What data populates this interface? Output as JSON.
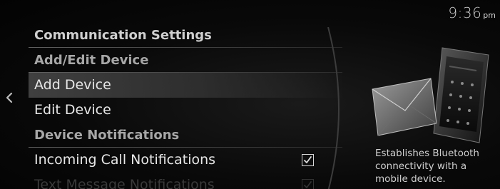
{
  "status": {
    "time": "9:36",
    "ampm": "pm"
  },
  "navigation": {
    "back_icon": "chevron-left-icon"
  },
  "menu": {
    "title": "Communication Settings",
    "section_add_edit": "Add/Edit Device",
    "items": [
      {
        "label": "Add Device",
        "selected": true
      },
      {
        "label": "Edit Device",
        "selected": false
      }
    ],
    "section_notifications": "Device Notifications",
    "notification_items": [
      {
        "label": "Incoming Call Notifications",
        "checked": true
      },
      {
        "label": "Text Message Notifications",
        "checked": true
      }
    ]
  },
  "info_panel": {
    "illustration": "envelope-and-phone-illustration",
    "description": "Establishes Bluetooth connectivity with a mobile device."
  },
  "colors": {
    "background": "#050505",
    "text_primary": "#e6e6e6",
    "text_header": "#cfcfcf",
    "selection_highlight": "#464646"
  }
}
